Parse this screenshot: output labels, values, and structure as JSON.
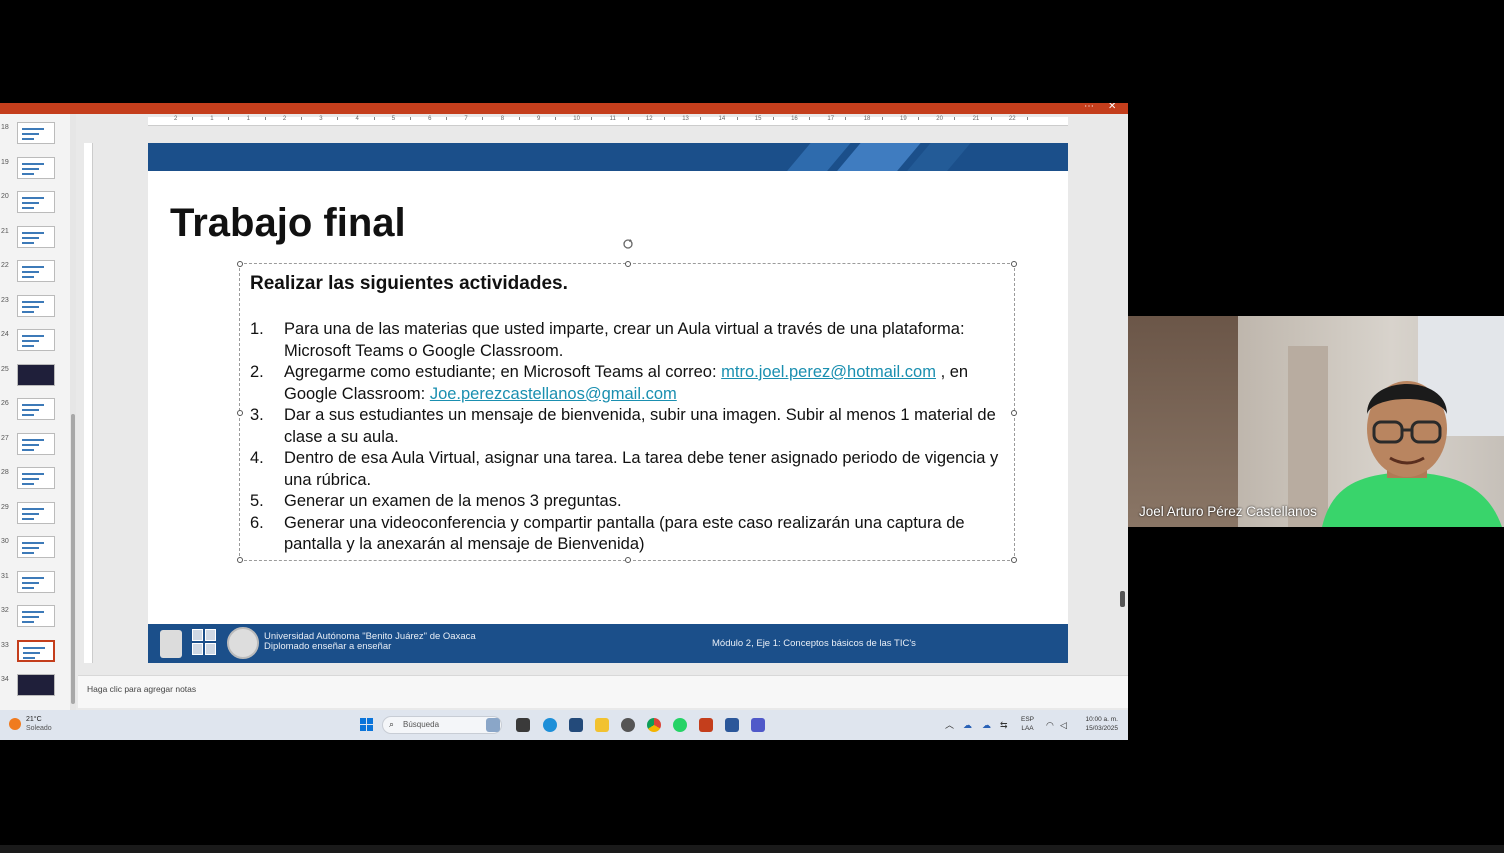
{
  "slide_thumbnails": [
    {
      "num": "18",
      "dark": false
    },
    {
      "num": "19",
      "dark": false
    },
    {
      "num": "20",
      "dark": false
    },
    {
      "num": "21",
      "dark": false
    },
    {
      "num": "22",
      "dark": false
    },
    {
      "num": "23",
      "dark": false
    },
    {
      "num": "24",
      "dark": false
    },
    {
      "num": "25",
      "dark": true
    },
    {
      "num": "26",
      "dark": false
    },
    {
      "num": "27",
      "dark": false
    },
    {
      "num": "28",
      "dark": false
    },
    {
      "num": "29",
      "dark": false
    },
    {
      "num": "30",
      "dark": false
    },
    {
      "num": "31",
      "dark": false
    },
    {
      "num": "32",
      "dark": false
    },
    {
      "num": "33",
      "dark": false,
      "selected": true
    },
    {
      "num": "34",
      "dark": true
    }
  ],
  "ruler": {
    "top_labels": [
      "2",
      "1",
      "1",
      "2",
      "3",
      "4",
      "5",
      "6",
      "7",
      "8",
      "9",
      "10",
      "11",
      "12",
      "13",
      "14",
      "15",
      "16",
      "17",
      "18",
      "19",
      "20",
      "21",
      "22"
    ]
  },
  "slide": {
    "title": "Trabajo final",
    "heading": "Realizar las siguientes actividades.",
    "items": [
      {
        "num": "1.",
        "text": "Para una de las materias que usted imparte, crear un Aula virtual a través de una plataforma: Microsoft Teams o Google Classroom."
      },
      {
        "num": "2.",
        "text_before": "Agregarme como estudiante; en Microsoft Teams al correo: ",
        "link1": "mtro.joel.perez@hotmail.com",
        "text_mid": " , en Google Classroom: ",
        "link2": "Joe.perezcastellanos@gmail.com"
      },
      {
        "num": "3.",
        "text": "Dar a sus estudiantes un mensaje de bienvenida, subir una imagen. Subir al menos 1 material de clase a su aula."
      },
      {
        "num": "4.",
        "text": "Dentro de esa Aula Virtual, asignar una tarea. La tarea debe tener asignado periodo de vigencia y una rúbrica."
      },
      {
        "num": "5.",
        "text": "Generar un examen de la menos 3 preguntas."
      },
      {
        "num": "6.",
        "text": "Generar una videoconferencia y compartir pantalla (para este caso realizarán una captura de pantalla y la anexarán al mensaje de Bienvenida)"
      }
    ],
    "footer": {
      "university": "Universidad Autónoma \"Benito Juárez\" de Oaxaca",
      "program": "Diplomado enseñar a enseñar",
      "module": "Módulo 2, Eje 1: Conceptos básicos de las TIC's"
    },
    "colors": {
      "band": "#1b4f8a",
      "title_bar": "#c43e1c",
      "link": "#1a8fb0"
    }
  },
  "notes_placeholder": "Haga clic para agregar notas",
  "taskbar": {
    "weather_temp": "21°C",
    "weather_desc": "Soleado",
    "search_placeholder": "Búsqueda",
    "lang_line1": "ESP",
    "lang_line2": "LAA",
    "time": "10:00 a. m.",
    "date": "15/03/2025",
    "icons": [
      "windows-start-icon",
      "search-icon",
      "widgets-icon",
      "file-explorer-icon",
      "edge-icon",
      "store-icon",
      "folder-icon",
      "media-icon",
      "chrome-icon",
      "whatsapp-icon",
      "powerpoint-icon",
      "word-icon",
      "teams-icon"
    ]
  },
  "participant": {
    "name": "Joel Arturo Pérez Castellanos"
  }
}
